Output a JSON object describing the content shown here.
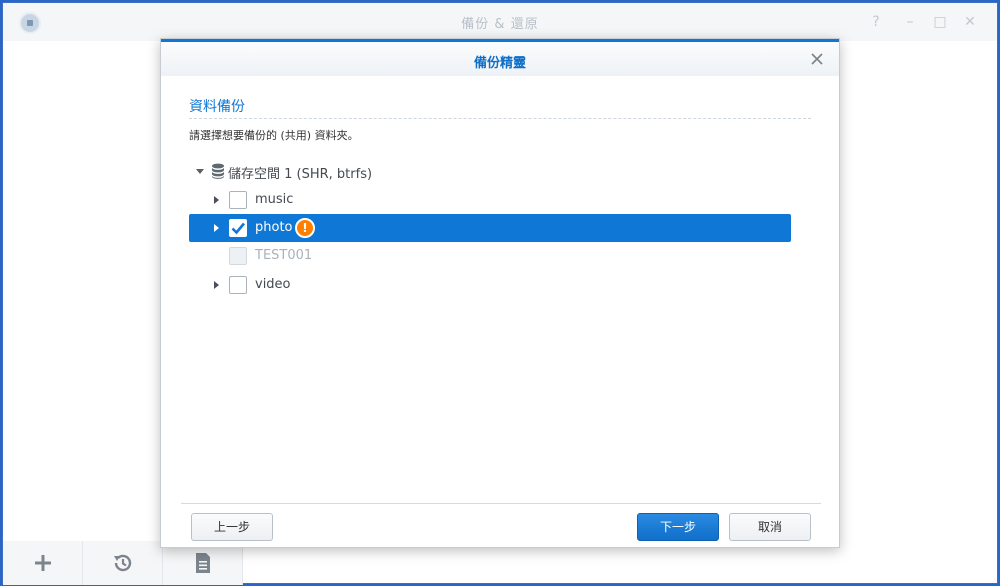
{
  "app": {
    "title": "備份 & 還原",
    "controls": {
      "help": "?",
      "minimize": "–",
      "maximize": "□",
      "close": "✕"
    }
  },
  "toolbar": {
    "items": [
      {
        "icon": "plus-icon"
      },
      {
        "icon": "restore-history-icon"
      },
      {
        "icon": "log-document-icon"
      }
    ]
  },
  "dialog": {
    "title": "備份精靈",
    "section_title": "資料備份",
    "instruction": "請選擇想要備份的 (共用) 資料夾。",
    "volume": {
      "label": "儲存空間 1 (SHR, btrfs)",
      "icon": "database-icon",
      "expanded": true
    },
    "folders": [
      {
        "name": "music",
        "checked": false,
        "expandable": true,
        "selected": false,
        "disabled": false
      },
      {
        "name": "photo",
        "checked": true,
        "expandable": true,
        "selected": true,
        "disabled": false,
        "warning_icon": "!"
      },
      {
        "name": "TEST001",
        "checked": false,
        "expandable": false,
        "selected": false,
        "disabled": true
      },
      {
        "name": "video",
        "checked": false,
        "expandable": true,
        "selected": false,
        "disabled": false
      }
    ],
    "buttons": {
      "back": "上一步",
      "next": "下一步",
      "cancel": "取消"
    }
  },
  "colors": {
    "accent": "#0f78d6",
    "warning": "#ff7f00",
    "desktop": "#2a66c8",
    "disabled_text": "#a9b2bb"
  }
}
